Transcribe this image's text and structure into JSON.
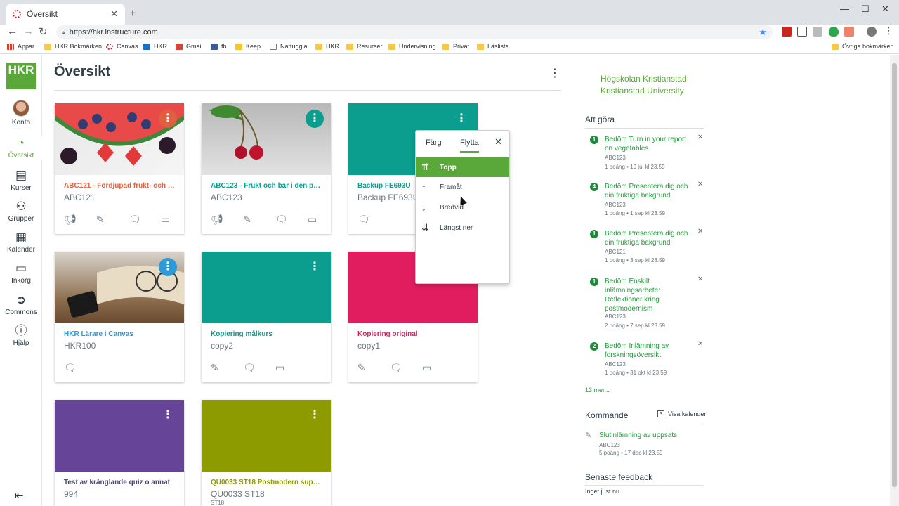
{
  "browser": {
    "tab_title": "Översikt",
    "tab_close": "✕",
    "new_tab": "+",
    "url": "https://hkr.instructure.com",
    "bookmarks": [
      "Appar",
      "HKR Bokmärken",
      "Canvas",
      "HKR",
      "Gmail",
      "fb",
      "Keep",
      "Nattuggla",
      "HKR",
      "Resurser",
      "Undervisning",
      "Privat",
      "Läslista"
    ],
    "other_bookmarks": "Övriga bokmärken"
  },
  "nav": {
    "logo": "HKR",
    "items": [
      {
        "label": "Konto"
      },
      {
        "label": "Översikt"
      },
      {
        "label": "Kurser"
      },
      {
        "label": "Grupper"
      },
      {
        "label": "Kalender"
      },
      {
        "label": "Inkorg"
      },
      {
        "label": "Commons"
      },
      {
        "label": "Hjälp"
      }
    ]
  },
  "page": {
    "title": "Översikt"
  },
  "cards": [
    {
      "title": "ABC121 - Fördjupad frukt- och bä...",
      "code": "ABC121",
      "term": "",
      "color": "#e0603f"
    },
    {
      "title": "ABC123 - Frukt och bär i den post...",
      "code": "ABC123",
      "term": "",
      "color": "#0b9e8e"
    },
    {
      "title": "Backup FE693U",
      "code": "Backup FE693U",
      "term": "",
      "color": "#0b9e8e"
    },
    {
      "title": "HKR Lärare i Canvas",
      "code": "HKR100",
      "term": "",
      "color": "#2d9ad8"
    },
    {
      "title": "Kopiering målkurs",
      "code": "copy2",
      "term": "",
      "color": "#0b9e8e"
    },
    {
      "title": "Kopiering original",
      "code": "copy1",
      "term": "",
      "color": "#e21d5f"
    },
    {
      "title": "Test av krånglande quiz o annat",
      "code": "994",
      "term": "",
      "color": "#664599"
    },
    {
      "title": "QU0033 ST18 Postmodern superi...",
      "code": "QU0033 ST18",
      "term": "ST18",
      "color": "#8d9b00"
    }
  ],
  "popover": {
    "tab_color": "Färg",
    "tab_move": "Flytta",
    "close": "✕",
    "items": [
      "Topp",
      "Framåt",
      "Bredvid",
      "Längst ner"
    ]
  },
  "sidebar": {
    "university_line1": "Högskolan Kristianstad",
    "university_line2": "Kristianstad University",
    "todo_header": "Att göra",
    "todos": [
      {
        "count": "1",
        "name": "Bedöm Turn in your report on vegetables",
        "course": "ABC123",
        "meta": "1 poäng • 19 jul kl 23.59"
      },
      {
        "count": "4",
        "name": "Bedöm Presentera dig och din fruktiga bakgrund",
        "course": "ABC123",
        "meta": "1 poäng • 1 sep kl 23.59"
      },
      {
        "count": "1",
        "name": "Bedöm Presentera dig och din fruktiga bakgrund",
        "course": "ABC121",
        "meta": "1 poäng • 3 sep kl 23.59"
      },
      {
        "count": "1",
        "name": "Bedöm Enskilt inlämningsarbete: Reflektioner kring postmodernism",
        "course": "ABC123",
        "meta": "2 poäng • 7 sep kl 23.59"
      },
      {
        "count": "2",
        "name": "Bedöm Inlämning av forskningsöversikt",
        "course": "ABC123",
        "meta": "1 poäng • 31 okt kl 23.59"
      }
    ],
    "more": "13 mer...",
    "upcoming_header": "Kommande",
    "view_calendar": "Visa kalender",
    "upcoming": {
      "name": "Slutinlämning av uppsats",
      "course": "ABC123",
      "meta": "5 poäng • 17 dec kl 23.59"
    },
    "feedback_header": "Senaste feedback",
    "feedback_empty": "Inget just nu"
  }
}
